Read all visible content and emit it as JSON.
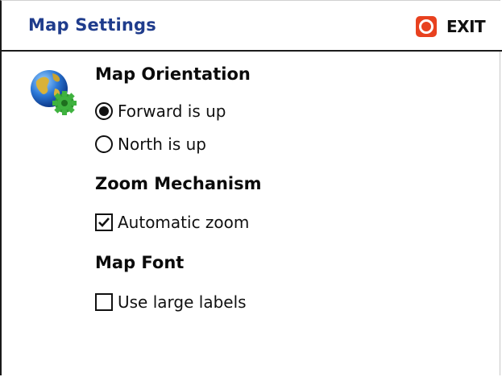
{
  "header": {
    "title": "Map Settings",
    "exit_label": "EXIT",
    "exit_icon": "stop-icon",
    "title_color": "#1f3c8c",
    "exit_color": "#e8411f"
  },
  "settings_icon": "globe-gear-icon",
  "sections": {
    "orientation": {
      "title": "Map Orientation",
      "options": [
        {
          "label": "Forward is up",
          "selected": true
        },
        {
          "label": "North is up",
          "selected": false
        }
      ]
    },
    "zoom": {
      "title": "Zoom Mechanism",
      "checkbox": {
        "label": "Automatic zoom",
        "checked": true
      }
    },
    "font": {
      "title": "Map Font",
      "checkbox": {
        "label": "Use large labels",
        "checked": false
      }
    }
  }
}
